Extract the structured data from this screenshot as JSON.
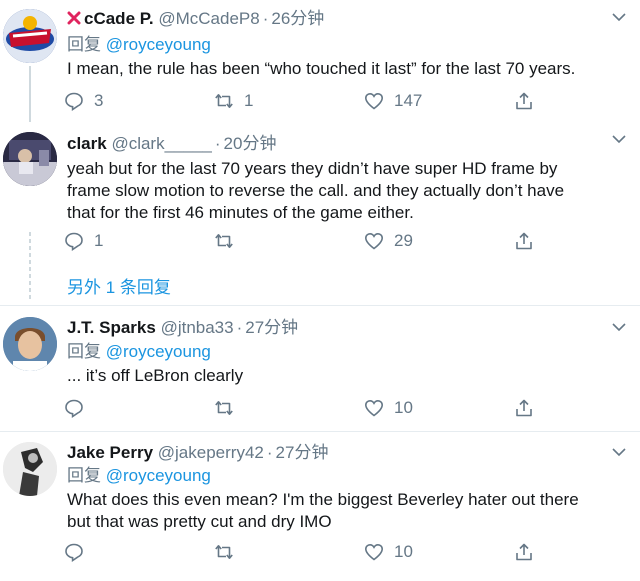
{
  "tweets": [
    {
      "name": "cCade P.",
      "handle": "@McCadeP8",
      "time": "26分钟",
      "replying_label": "回复",
      "replying_to": "@royceyoung",
      "text_lines": [
        "I mean, the rule has been “who touched it last” for the last 70 years."
      ],
      "replies": "3",
      "retweets": "1",
      "likes": "147"
    },
    {
      "name": "clark",
      "handle": "@clark_____",
      "time": "20分钟",
      "text_lines": [
        "yeah but for the last 70 years they didn’t have super HD frame by",
        "frame slow motion to reverse the call. and they actually don’t have",
        "that for the first 46 minutes of the game either."
      ],
      "replies": "1",
      "retweets": "",
      "likes": "29",
      "more_replies": "另外 1 条回复"
    },
    {
      "name": "J.T. Sparks",
      "handle": "@jtnba33",
      "time": "27分钟",
      "replying_label": "回复",
      "replying_to": "@royceyoung",
      "text_lines": [
        "... it’s off LeBron clearly"
      ],
      "replies": "",
      "retweets": "",
      "likes": "10"
    },
    {
      "name": "Jake Perry",
      "handle": "@jakeperry42",
      "time": "27分钟",
      "replying_label": "回复",
      "replying_to": "@royceyoung",
      "text_lines": [
        "What does this even mean? I'm the biggest Beverley hater out there",
        "but that was pretty cut and dry IMO"
      ],
      "replies": "",
      "retweets": "",
      "likes": "10"
    }
  ],
  "colors": {
    "name": "#14171a",
    "secondary": "#657786",
    "link": "#1b95e0",
    "name_prefix_mark": "#e0245e",
    "divider": "#e6ecf0"
  },
  "icons": {
    "reply": "reply-icon",
    "retweet": "retweet-icon",
    "like": "heart-icon",
    "share": "share-icon",
    "menu": "chevron-down-icon"
  }
}
